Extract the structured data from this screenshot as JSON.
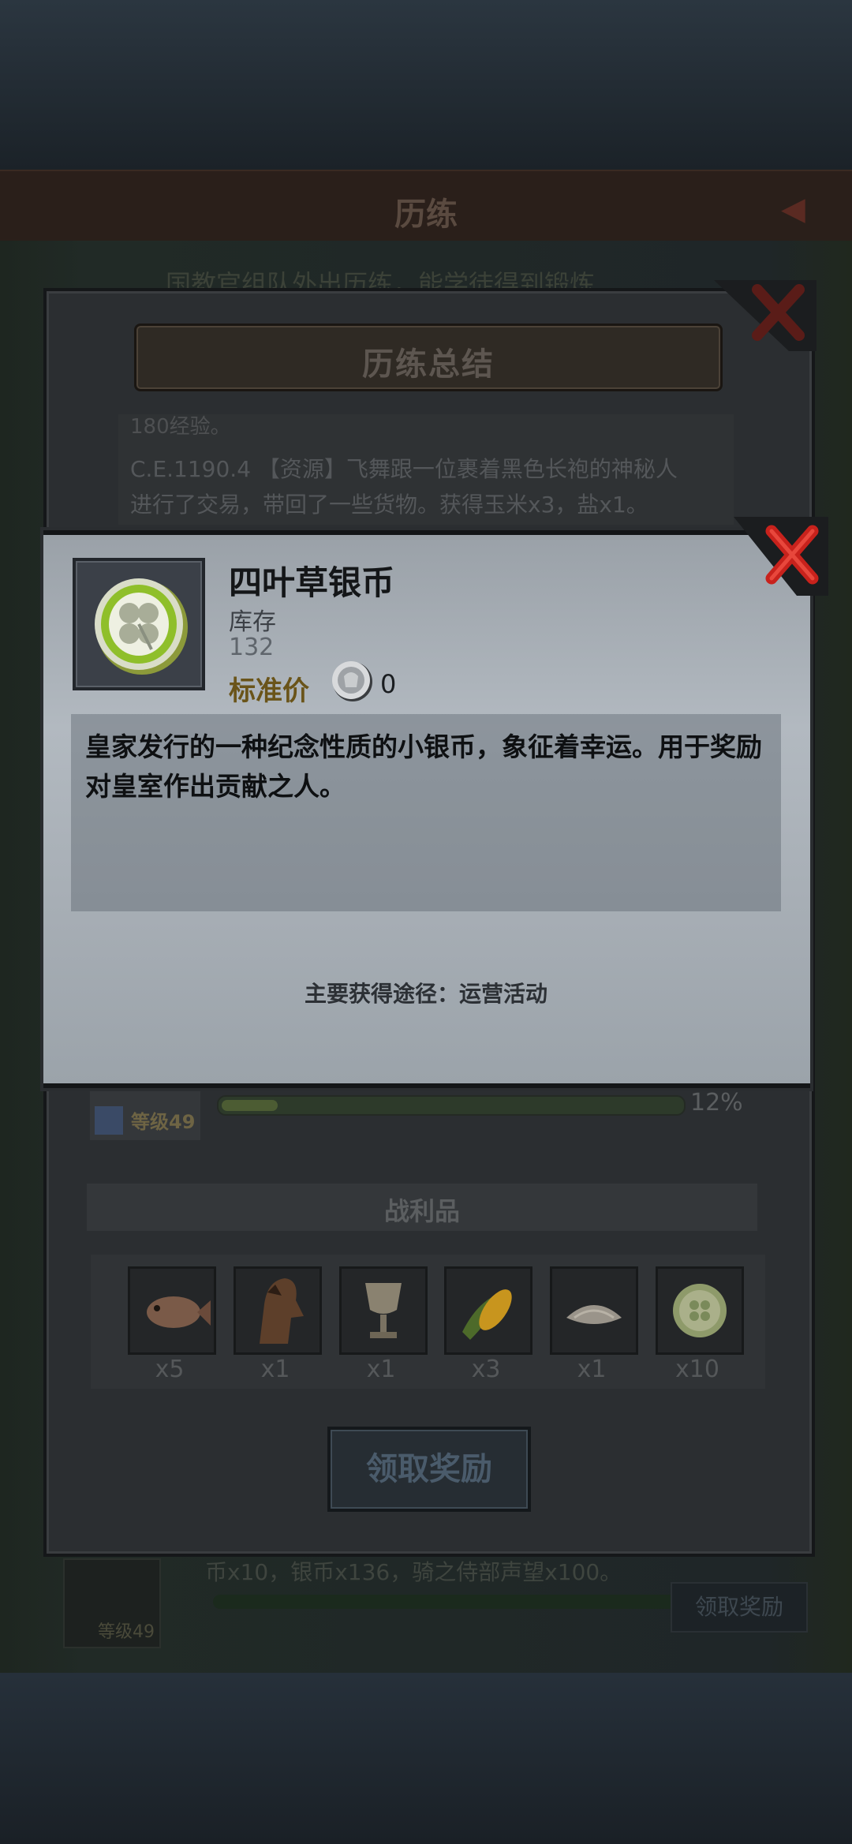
{
  "background": {
    "header_title": "历练",
    "note": "国教官组队外出历练，能学徒得到锻炼",
    "row_text": "币x10，银币x136，骑之侍部声望x100。",
    "row_level": "等级49",
    "row_claim": "领取奖励"
  },
  "summary": {
    "title": "历练总结",
    "log_cut": "180经验。",
    "log_lines": [
      "C.E.1190.4 【资源】飞舞跟一位裹着黑色长袍的神秘人",
      "进行了交易，带回了一些货物。获得玉米x3，盐x1。"
    ],
    "hero": {
      "level": "等级49",
      "exp_percent_label": "12%",
      "exp_fraction": 0.12
    },
    "loot_title": "战利品",
    "loot": [
      {
        "icon": "fish-icon",
        "count": "x5"
      },
      {
        "icon": "horse-icon",
        "count": "x1"
      },
      {
        "icon": "goblet-icon",
        "count": "x1"
      },
      {
        "icon": "corn-icon",
        "count": "x3"
      },
      {
        "icon": "salt-icon",
        "count": "x1"
      },
      {
        "icon": "clover-coin-icon",
        "count": "x10"
      }
    ],
    "claim_button": "领取奖励"
  },
  "item": {
    "name": "四叶草银币",
    "stock_label": "库存",
    "stock_value": "132",
    "price_label": "标准价",
    "price_value": "0",
    "description": "皇家发行的一种纪念性质的小银币，象征着幸运。用于奖励对皇室作出贡献之人。",
    "source": "主要获得途径：运营活动",
    "icon": "clover-coin-icon"
  },
  "colors": {
    "close_red": "#c8221c",
    "coin_green": "#8fbf2a",
    "price_label": "#6a5419"
  }
}
